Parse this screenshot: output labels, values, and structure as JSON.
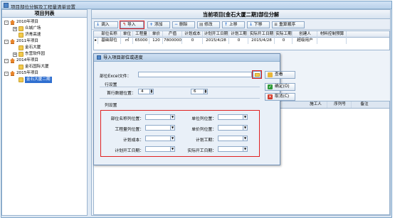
{
  "window": {
    "title": "项目部位分解及工程量清单设置"
  },
  "left": {
    "header": "项目列表",
    "tree": [
      {
        "label": "2010年项目",
        "level": 0,
        "toggle": "-",
        "icon": "house-icon"
      },
      {
        "label": "众城广场",
        "level": 1,
        "toggle": "+",
        "icon": "folder-icon"
      },
      {
        "label": "济青高速",
        "level": 1,
        "toggle": "",
        "icon": "folder-icon"
      },
      {
        "label": "2011年项目",
        "level": 0,
        "toggle": "-",
        "icon": "house-icon"
      },
      {
        "label": "金石大厦",
        "level": 1,
        "toggle": "",
        "icon": "folder-icon"
      },
      {
        "label": "东营软件园",
        "level": 1,
        "toggle": "+",
        "icon": "folder-icon"
      },
      {
        "label": "2014年项目",
        "level": 0,
        "toggle": "-",
        "icon": "house-icon"
      },
      {
        "label": "金石国际大厦",
        "level": 1,
        "toggle": "",
        "icon": "folder-icon"
      },
      {
        "label": "2015年项目",
        "level": 0,
        "toggle": "-",
        "icon": "house-icon"
      },
      {
        "label": "金石大厦二期",
        "level": 1,
        "toggle": "",
        "icon": "folder-icon",
        "selected": true
      }
    ]
  },
  "right": {
    "header": "当前项目[金石大厦二期]部位分解",
    "toolbar": {
      "import_in": "调入",
      "import": "导入",
      "add": "添加",
      "delete": "删除",
      "edit": "修改",
      "up": "上移",
      "down": "下移",
      "reorder": "重算顺序"
    },
    "grid": {
      "columns": [
        "部位名称",
        "单位",
        "工程量",
        "单价",
        "产值",
        "计划成本",
        "计划开工日期",
        "计划工期",
        "实际开工日期",
        "实际工期",
        "创建人",
        "材料控制预算"
      ],
      "row": [
        "基础部位",
        "㎡",
        "65000",
        "120",
        "7800000",
        "0",
        "2015/4/28",
        "0",
        "2015/4/28",
        "0",
        "超级用户",
        ""
      ]
    },
    "grid2": {
      "columns": [
        "施工人",
        "序列号",
        "备注"
      ]
    }
  },
  "dialog": {
    "title": "导入项目部位或进度",
    "file_label": "部位Excel文件：",
    "file_value": "",
    "row_section": "行设置",
    "first_row_label": "首行数据位置：",
    "first_row_value": "4",
    "second_value": "6",
    "col_section": "列设置",
    "view_button": "查看",
    "ok_button": "确定(O)",
    "cancel_button": "取消(C)",
    "fields": {
      "name_col": "部位名称列位置：",
      "unit_col": "单位列位置：",
      "qty_col": "工程量列位置：",
      "price_col": "单价列位置：",
      "plan_cost": "计划成本：",
      "plan_period": "计划工期：",
      "plan_start": "计划开工日期：",
      "actual_start": "实际开工日期："
    }
  },
  "colors": {
    "highlight": "#e02020",
    "selected": "#2f6fd0"
  }
}
